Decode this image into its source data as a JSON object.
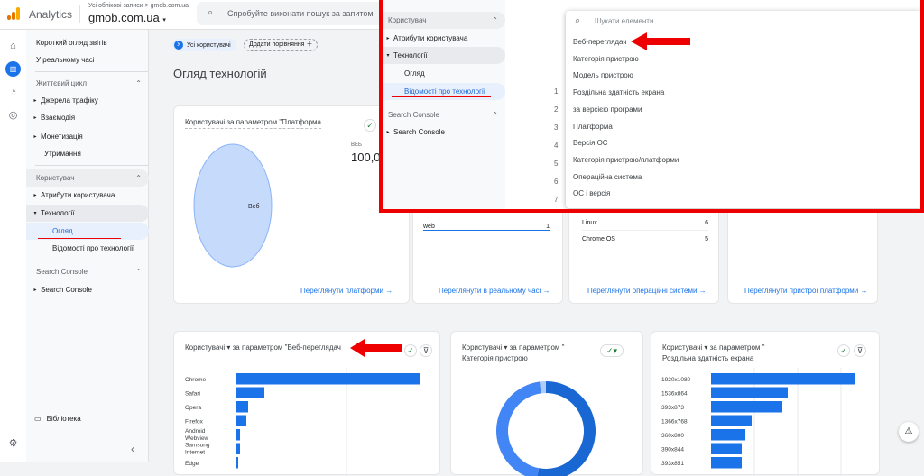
{
  "header": {
    "app_name": "Analytics",
    "breadcrumb": "Усі облікові записи > gmob.com.ua",
    "property": "gmob.com.ua",
    "search_placeholder": "Спробуйте виконати пошук за запитом"
  },
  "rail": {
    "icons": [
      "home-icon",
      "reports-icon",
      "explore-icon",
      "advertising-icon"
    ],
    "settings_icon": "gear-icon"
  },
  "nav": {
    "items": [
      {
        "label": "Короткий огляд звітів"
      },
      {
        "label": "У реальному часі"
      },
      {
        "label": "Життєвий цикл"
      },
      {
        "label": "Джерела трафіку"
      },
      {
        "label": "Взаємодія"
      },
      {
        "label": "Монетизація"
      },
      {
        "label": "Утримання"
      },
      {
        "label": "Користувач"
      },
      {
        "label": "Атрибути користувача"
      },
      {
        "label": "Технології"
      },
      {
        "label": "Огляд"
      },
      {
        "label": "Відомості про технології"
      },
      {
        "label": "Search Console"
      },
      {
        "label": "Search Console"
      }
    ],
    "library": "Бібліотека"
  },
  "filters": {
    "segment_badge": "У",
    "segment": "Усі користувачі",
    "compare": "Додати порівняння"
  },
  "page_title": "Огляд технологій",
  "cards": {
    "platform": {
      "title": "Користувачі за параметром \"Платформа",
      "legend_label": "ВЕБ",
      "legend_value": "100,0",
      "slice_label": "Веб",
      "link": "Переглянути платформи"
    },
    "realtime": {
      "row_label": "web",
      "row_value": "1",
      "link": "Переглянути в реальному часі"
    },
    "os": {
      "rows": [
        {
          "label": "Linux",
          "value": "6"
        },
        {
          "label": "Chrome OS",
          "value": "5"
        }
      ],
      "link": "Переглянути операційні системи"
    },
    "platform_device": {
      "link": "Переглянути пристрої платформи"
    },
    "browser": {
      "metric": "Користувачі",
      "title": "за параметром \"Веб-переглядач"
    },
    "device": {
      "metric": "Користувачі",
      "title": "за параметром \"",
      "title2": "Категорія пристрою"
    },
    "resolution": {
      "metric": "Користувачі",
      "title": "за параметром \"",
      "title2": "Роздільна здатність екрана"
    }
  },
  "overlay": {
    "nav": [
      {
        "label": "Користувач"
      },
      {
        "label": "Атрибути користувача"
      },
      {
        "label": "Технології"
      },
      {
        "label": "Огляд"
      },
      {
        "label": "Відомості про технології"
      },
      {
        "label": "Search Console"
      },
      {
        "label": "Search Console"
      }
    ],
    "row_numbers": [
      "1",
      "2",
      "3",
      "4",
      "5",
      "6",
      "7"
    ],
    "search_placeholder": "Шукати елементи",
    "options": [
      "Веб-переглядач",
      "Категорія пристрою",
      "Модель пристрою",
      "Роздільна здатність екрана",
      "за версією програми",
      "Платформа",
      "Версія ОС",
      "Категорія пристрою/платформи",
      "Операційна система",
      "ОС і версія"
    ]
  },
  "chart_data": [
    {
      "type": "pie",
      "slices": [
        {
          "label": "Веб",
          "value": 100
        }
      ],
      "colors": [
        "#c6dafc"
      ]
    },
    {
      "type": "bar",
      "orientation": "horizontal",
      "categories": [
        "Chrome",
        "Safari",
        "Opera",
        "Firefox",
        "Android Webview",
        "Samsung Internet",
        "Edge"
      ],
      "values": [
        205,
        32,
        14,
        12,
        5,
        5,
        3
      ]
    },
    {
      "type": "pie",
      "donut": true,
      "values": [
        53,
        45,
        2
      ],
      "colors": [
        "#1967d2",
        "#4285f4",
        "#aecbfa"
      ]
    },
    {
      "type": "bar",
      "orientation": "horizontal",
      "categories": [
        "1920x1080",
        "1536x864",
        "393x873",
        "1366x768",
        "360x800",
        "390x844",
        "393x851"
      ],
      "values": [
        160,
        85,
        79,
        45,
        38,
        34,
        34
      ]
    }
  ],
  "colors": {
    "accent": "#1a73e8",
    "bar": "#1a73e8",
    "annotation": "#e00000"
  }
}
